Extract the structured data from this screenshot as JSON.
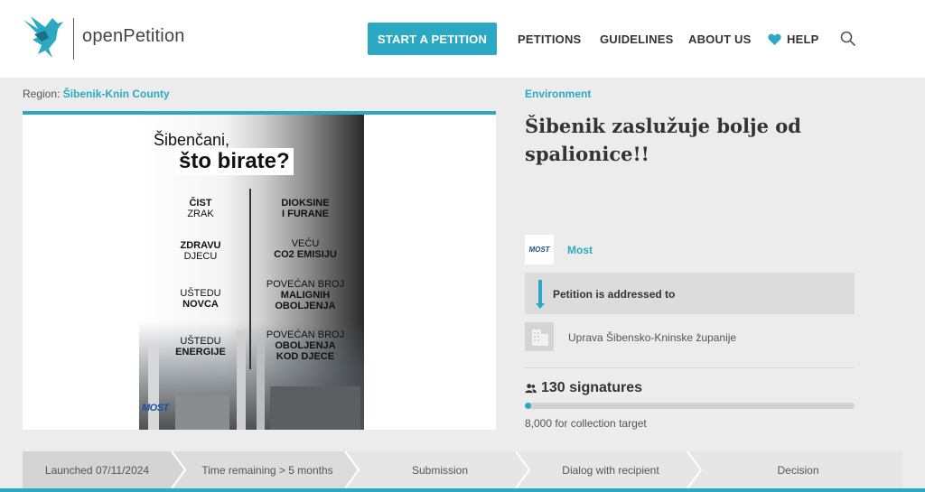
{
  "header": {
    "brand": "openPetition",
    "start_button": "START A PETITION",
    "nav": {
      "petitions": "PETITIONS",
      "guidelines": "GUIDELINES",
      "about": "ABOUT US",
      "help": "HELP"
    },
    "accent_color": "#2ba9c3"
  },
  "region": {
    "label": "Region:",
    "value": "Šibenik-Knin County"
  },
  "poster": {
    "line1": "Šibenčani,",
    "line2": "što birate?",
    "left": [
      {
        "a": "ČIST",
        "b": "ZRAK"
      },
      {
        "a": "ZDRAVU",
        "b": "DJECU"
      },
      {
        "a": "UŠTEDU",
        "b": "NOVCA"
      },
      {
        "a": "UŠTEDU",
        "b": "ENERGIJE"
      }
    ],
    "right": [
      {
        "a": "DIOKSINE",
        "b": "I FURANE"
      },
      {
        "a": "VEĆU",
        "b": "CO2 EMISIJU"
      },
      {
        "a": "POVEĆAN BROJ",
        "b": "MALIGNIH",
        "c": "OBOLJENJA"
      },
      {
        "a": "POVEĆAN BROJ",
        "b": "OBOLJENJA",
        "c": "KOD DJECE"
      }
    ],
    "logo": "MOST"
  },
  "petition": {
    "category": "Environment",
    "title": "Šibenik zaslužuje bolje od spalionice!!",
    "org_logo": "MOST",
    "org_name": "Most",
    "addressed_label": "Petition is addressed to",
    "recipient": "Uprava Šibensko-Kninske županije",
    "signatures": "130 signatures",
    "signature_count": 130,
    "target_count": 8000,
    "target_text": "8,000 for collection target"
  },
  "steps": [
    {
      "label": "Launched 07/11/2024",
      "active": true
    },
    {
      "label": "Time remaining > 5 months",
      "active": true
    },
    {
      "label": "Submission",
      "active": false
    },
    {
      "label": "Dialog with recipient",
      "active": false
    },
    {
      "label": "Decision",
      "active": false
    }
  ]
}
